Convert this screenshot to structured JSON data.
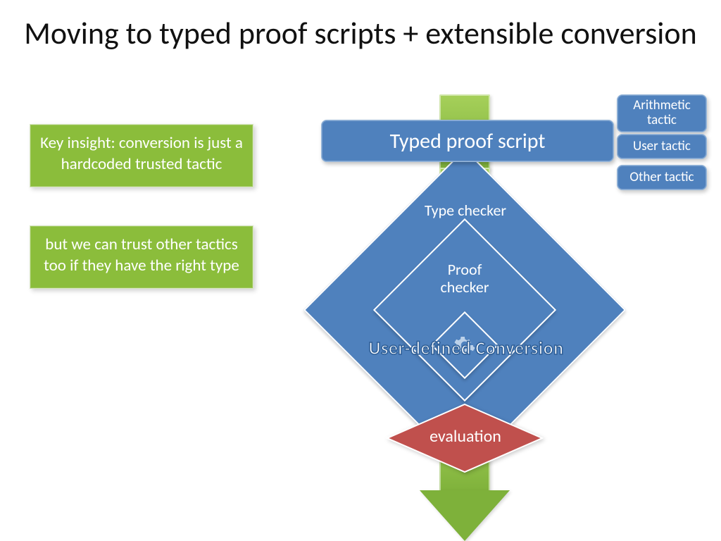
{
  "title": "Moving to typed proof scripts + extensible conversion",
  "callouts": {
    "insight": "Key insight: conversion is just a hardcoded trusted tactic",
    "trust": "but we can trust other tactics too if they have the right type"
  },
  "flow": {
    "typed_proof_script": "Typed proof script",
    "type_checker": "Type checker",
    "proof_checker": "Proof checker",
    "user_defined_conversion": "User-defined Conversion",
    "evaluation": "evaluation"
  },
  "tactics": {
    "arithmetic": "Arithmetic tactic",
    "user": "User tactic",
    "other": "Other tactic"
  },
  "colors": {
    "green": "#8bbd3b",
    "blue": "#4f81bd",
    "red": "#c0504d"
  }
}
